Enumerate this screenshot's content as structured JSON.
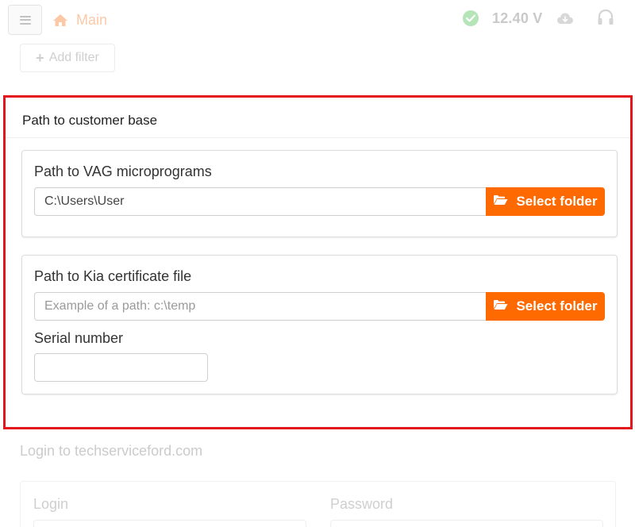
{
  "header": {
    "home_label": "Main",
    "voltage": "12.40 V",
    "status_icon": "check-circle-icon",
    "cloud_icon": "cloud-download-icon",
    "support_icon": "headset-icon"
  },
  "filter": {
    "add_label": "Add filter"
  },
  "customer_base": {
    "title": "Path to customer base",
    "vag": {
      "label": "Path to VAG microprograms",
      "value": "C:\\Users\\User",
      "button_label": "Select folder"
    },
    "kia": {
      "label": "Path to Kia certificate file",
      "placeholder": "Example of a path: c:\\temp",
      "value": "",
      "button_label": "Select folder"
    },
    "serial": {
      "label": "Serial number",
      "value": ""
    }
  },
  "ford_login": {
    "title": "Login to techserviceford.com",
    "login_label": "Login",
    "password_label": "Password"
  },
  "colors": {
    "accent": "#ff6a00",
    "highlight_border": "#e3161d"
  }
}
